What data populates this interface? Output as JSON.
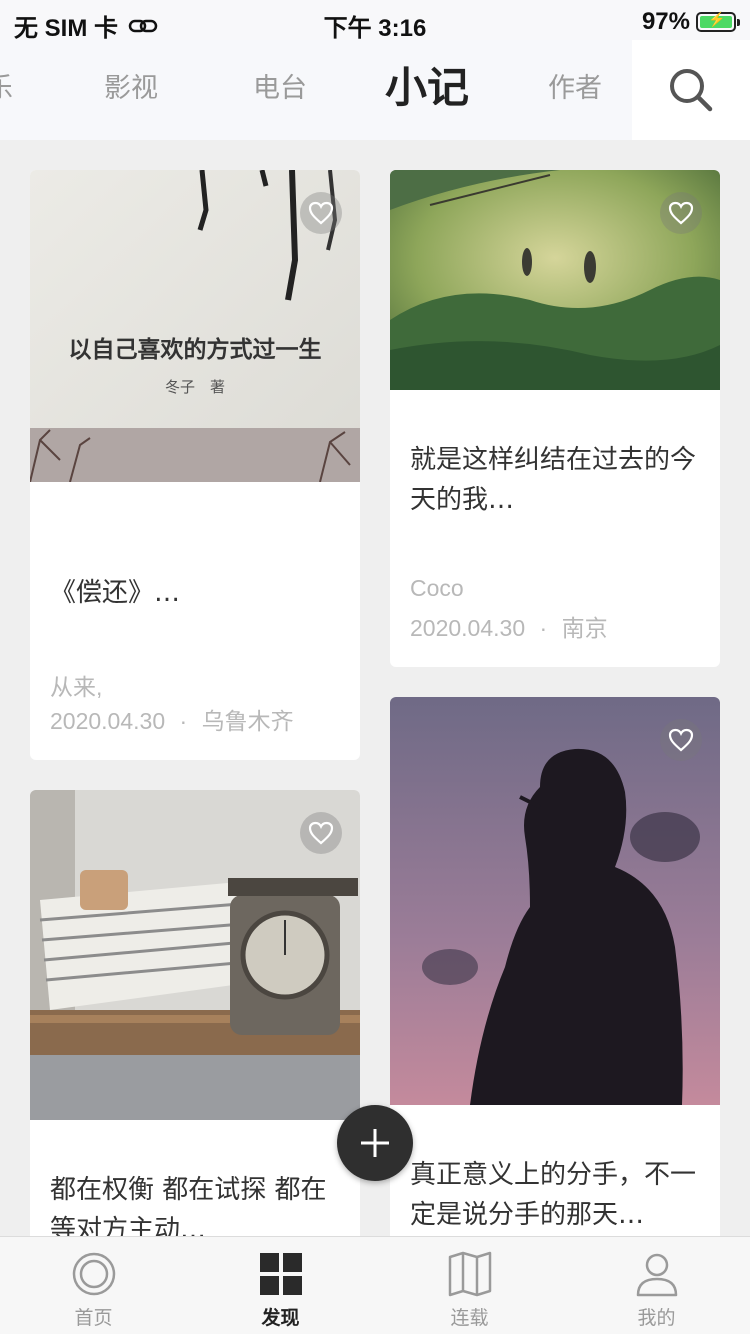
{
  "status_bar": {
    "carrier": "无 SIM 卡",
    "time": "下午 3:16",
    "battery": "97%"
  },
  "top_nav": {
    "partial_tab": "乐",
    "tabs": [
      "影视",
      "电台",
      "小记",
      "作者"
    ],
    "active_tab": "小记"
  },
  "cards": [
    {
      "image_title": "以自己喜欢的方式过一生",
      "image_author": "冬子　著",
      "title": "《偿还》…",
      "author": "从来,",
      "date": "2020.04.30",
      "location": "乌鲁木齐"
    },
    {
      "title": "就是这样纠结在过去的今天的我…",
      "author": "Coco",
      "date": "2020.04.30",
      "location": "南京"
    },
    {
      "title": "都在权衡 都在试探 都在等对方主动…"
    },
    {
      "title": "真正意义上的分手，不一定是说分手的那天…"
    }
  ],
  "meta_separator": "·",
  "tab_bar": {
    "items": [
      {
        "label": "首页",
        "icon": "home-circle-icon"
      },
      {
        "label": "发现",
        "icon": "grid-icon"
      },
      {
        "label": "连载",
        "icon": "book-icon"
      },
      {
        "label": "我的",
        "icon": "person-icon"
      }
    ],
    "active": "发现"
  },
  "colors": {
    "accent_dark": "#2f2f2f",
    "battery_green": "#4cd964",
    "muted_text": "#b8b8b8"
  }
}
